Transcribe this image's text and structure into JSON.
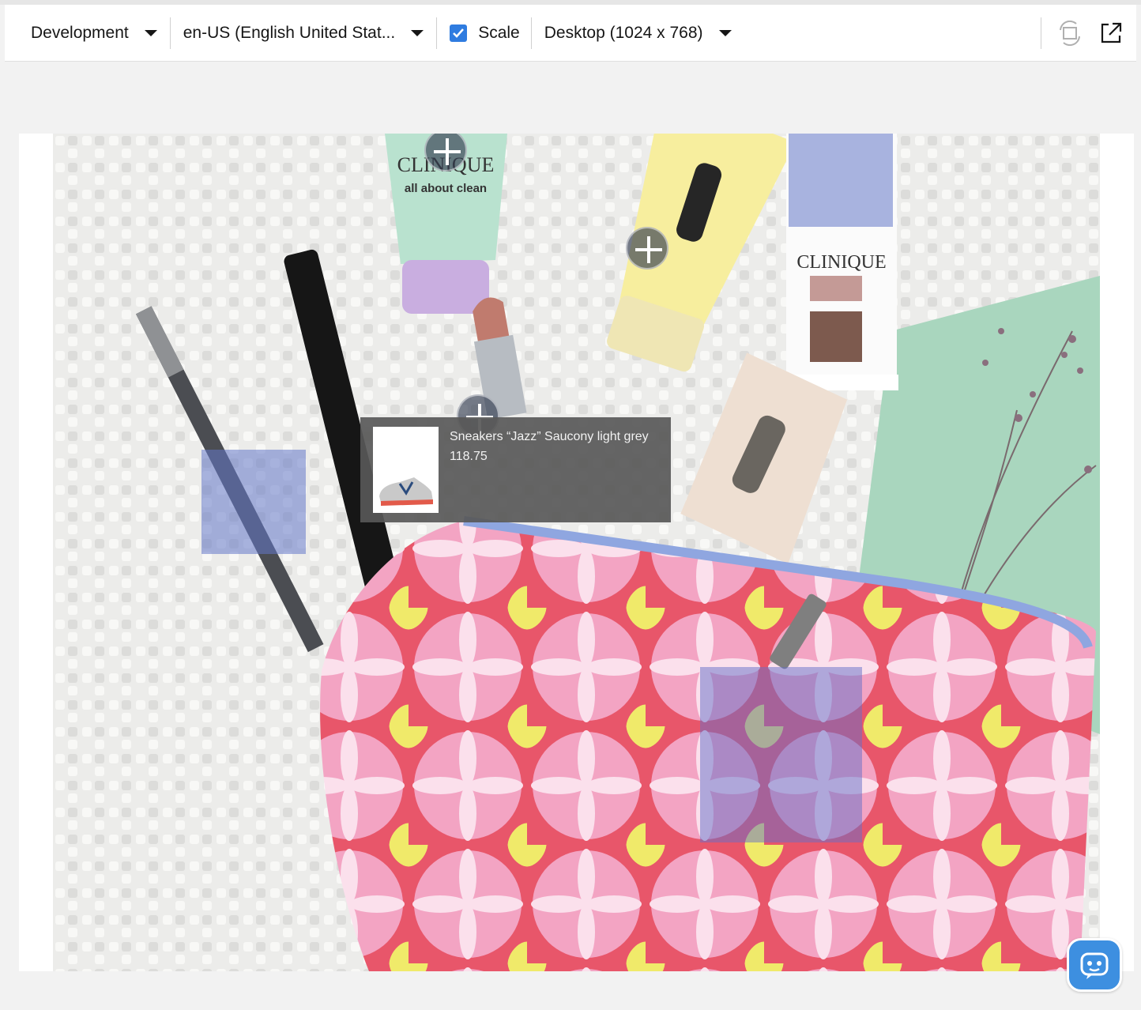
{
  "toolbar": {
    "environment": "Development",
    "locale": "en-US (English United Stat...",
    "scale_label": "Scale",
    "scale_checked": true,
    "device": "Desktop (1024 x 768)",
    "icons": [
      "rotate-icon",
      "external-link-icon"
    ]
  },
  "preview": {
    "tooltip": {
      "product_name": "Sneakers “Jazz” Saucony light grey",
      "price": "118.75"
    },
    "photo_labels": {
      "tube1_brand": "CLINIQUE",
      "tube1_name": "all about clean",
      "palette_brand": "CLINIQUE"
    }
  },
  "colors": {
    "accent": "#2f7ce0",
    "hotspot": "#6478c8",
    "assistant": "#3d8fe0"
  }
}
